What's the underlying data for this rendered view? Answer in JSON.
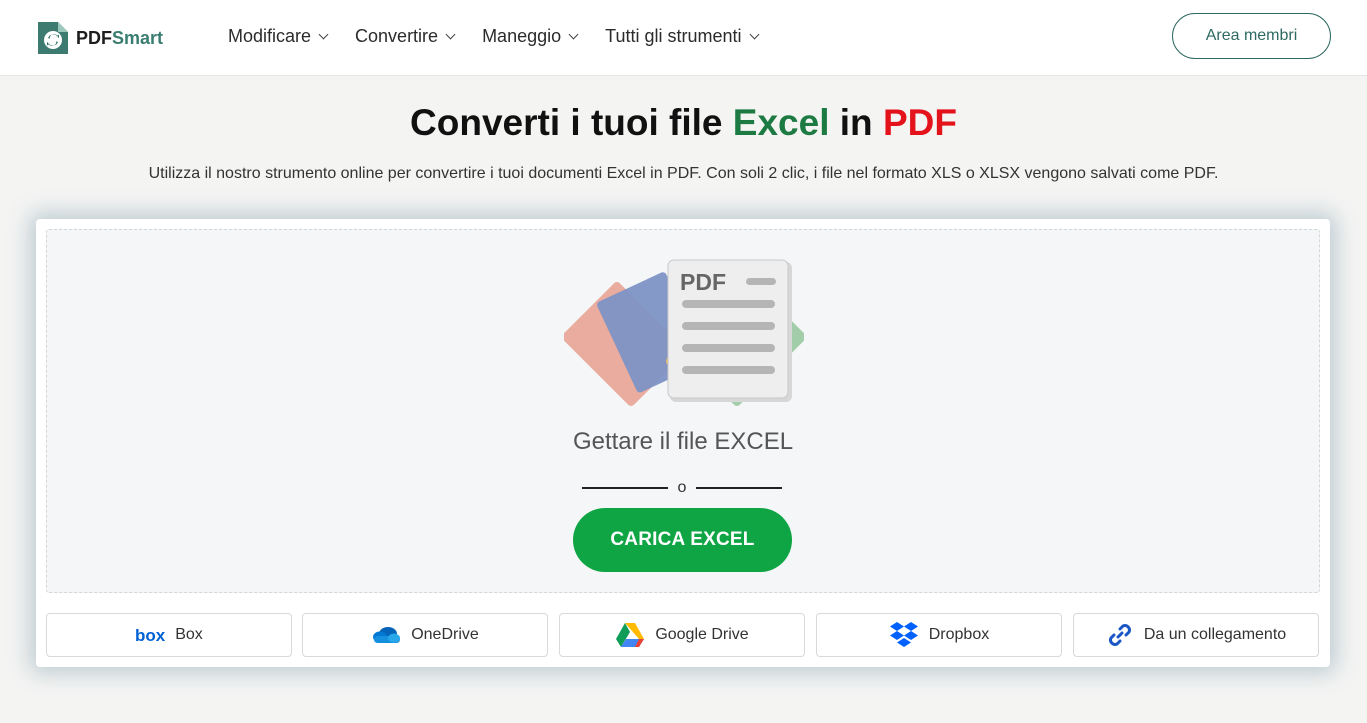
{
  "header": {
    "logo": {
      "part1": "PDF",
      "part2": "Smart"
    },
    "nav": [
      {
        "label": "Modificare"
      },
      {
        "label": "Convertire"
      },
      {
        "label": "Maneggio"
      },
      {
        "label": "Tutti gli strumenti"
      }
    ],
    "member_button": "Area membri"
  },
  "hero": {
    "title_prefix": "Converti i tuoi file ",
    "title_excel": "Excel",
    "title_mid": " in ",
    "title_pdf": "PDF",
    "subtitle": "Utilizza il nostro strumento online per convertire i tuoi documenti Excel in PDF. Con soli 2 clic, i file nel formato XLS o XLSX vengono salvati come PDF."
  },
  "dropzone": {
    "illustration_text": "PDF",
    "label": "Gettare il file EXCEL",
    "or": "o",
    "upload_button": "CARICA EXCEL"
  },
  "sources": [
    {
      "label": "Box",
      "icon": "box-icon"
    },
    {
      "label": "OneDrive",
      "icon": "onedrive-icon"
    },
    {
      "label": "Google Drive",
      "icon": "google-drive-icon"
    },
    {
      "label": "Dropbox",
      "icon": "dropbox-icon"
    },
    {
      "label": "Da un collegamento",
      "icon": "link-icon"
    }
  ],
  "colors": {
    "brand": "#3a7d70",
    "excel_green": "#1c7a42",
    "pdf_red": "#e3121b",
    "upload_button": "#0fa544"
  }
}
